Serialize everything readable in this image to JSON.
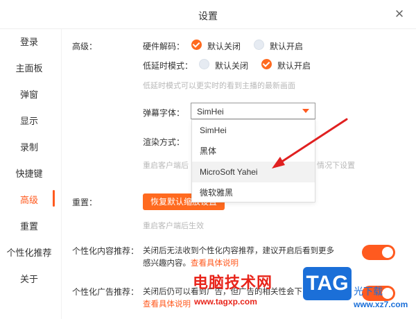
{
  "window": {
    "title": "设置",
    "close_glyph": "×"
  },
  "sidebar": {
    "items": [
      {
        "label": "登录"
      },
      {
        "label": "主面板"
      },
      {
        "label": "弹窗"
      },
      {
        "label": "显示"
      },
      {
        "label": "录制"
      },
      {
        "label": "快捷键"
      },
      {
        "label": "高级",
        "active": true
      },
      {
        "label": "重置"
      },
      {
        "label": "个性化推荐"
      },
      {
        "label": "关于"
      }
    ],
    "active_color": "#ff5a1f"
  },
  "advanced": {
    "section_label": "高级：",
    "hw_decode": {
      "label": "硬件解码：",
      "opt_off": "默认关闭",
      "opt_on": "默认开启",
      "selected": "默认关闭"
    },
    "low_latency": {
      "label": "低延时模式：",
      "opt_off": "默认关闭",
      "opt_on": "默认开启",
      "selected": "默认开启"
    },
    "low_latency_hint": "低延时模式可以更实时的看到主播的最新画面",
    "danmaku_font": {
      "label": "弹幕字体：",
      "value": "SimHei",
      "options": [
        "SimHei",
        "黑体",
        "MicroSoft Yahei",
        "微软雅黑"
      ],
      "hovered": "MicroSoft Yahei"
    },
    "render": {
      "label": "渲染方式："
    },
    "render_hint_left": "重启客户端后",
    "render_hint_right": "情况下设置"
  },
  "reset": {
    "section_label": "重置：",
    "button_label": "恢复默认缩放设置",
    "hint": "重启客户端后生效"
  },
  "personal_content": {
    "label": "个性化内容推荐：",
    "desc_line1": "关闭后无法收到个性化内容推荐，建议开启后看到更多",
    "desc_line2": "感兴趣内容。",
    "link": "查看具体说明",
    "enabled": true
  },
  "personal_ads": {
    "label": "个性化广告推荐：",
    "desc_line1": "关闭后仍可以看到广告，但广告的相关性会下",
    "link": "查看具体说明",
    "enabled": true
  },
  "watermark": {
    "cn_text": "电脑技术网",
    "url": "www.tagxp.com",
    "tag": "TAG",
    "site": "www.xz7.com",
    "light": "光下载"
  },
  "colors": {
    "accent": "#ff5a1f",
    "arrow": "#e02020",
    "watermark_red": "#e8241a",
    "watermark_blue": "#1b6fd8"
  }
}
